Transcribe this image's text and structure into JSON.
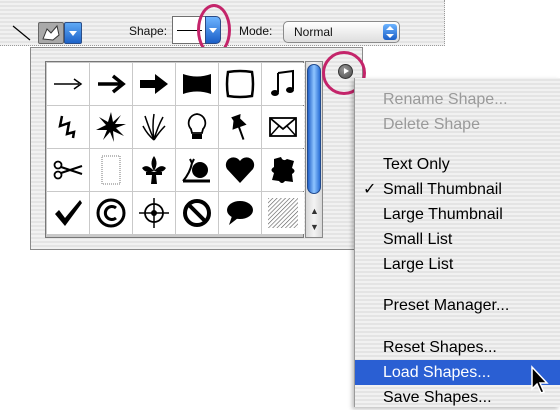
{
  "options_bar": {
    "shape_label": "Shape:",
    "mode_label": "Mode:",
    "mode_value": "Normal"
  },
  "shape_grid": {
    "shapes": [
      "thin-arrow",
      "arrow",
      "bold-arrow",
      "banner",
      "frame",
      "music-note",
      "lightning",
      "starburst",
      "grass",
      "lightbulb",
      "pushpin",
      "envelope",
      "scissors",
      "blank-card",
      "fleur-de-lis",
      "snail",
      "heart",
      "puzzle-piece",
      "checkmark",
      "copyright",
      "target",
      "no-symbol",
      "speech-bubble",
      "diagonal-pattern"
    ]
  },
  "menu": {
    "items": [
      {
        "label": "Rename Shape...",
        "enabled": false,
        "checked": false,
        "selected": false
      },
      {
        "label": "Delete Shape",
        "enabled": false,
        "checked": false,
        "selected": false
      },
      {
        "label": "Text Only",
        "enabled": true,
        "checked": false,
        "selected": false
      },
      {
        "label": "Small Thumbnail",
        "enabled": true,
        "checked": true,
        "selected": false
      },
      {
        "label": "Large Thumbnail",
        "enabled": true,
        "checked": false,
        "selected": false
      },
      {
        "label": "Small List",
        "enabled": true,
        "checked": false,
        "selected": false
      },
      {
        "label": "Large List",
        "enabled": true,
        "checked": false,
        "selected": false
      },
      {
        "label": "Preset Manager...",
        "enabled": true,
        "checked": false,
        "selected": false
      },
      {
        "label": "Reset Shapes...",
        "enabled": true,
        "checked": false,
        "selected": false
      },
      {
        "label": "Load Shapes...",
        "enabled": true,
        "checked": false,
        "selected": true
      },
      {
        "label": "Save Shapes...",
        "enabled": true,
        "checked": false,
        "selected": false
      }
    ],
    "check_glyph": "✓"
  },
  "colors": {
    "highlight_circle": "#c4246a",
    "menu_selection": "#2a5fd3",
    "disabled_text": "#9a9a9a"
  }
}
